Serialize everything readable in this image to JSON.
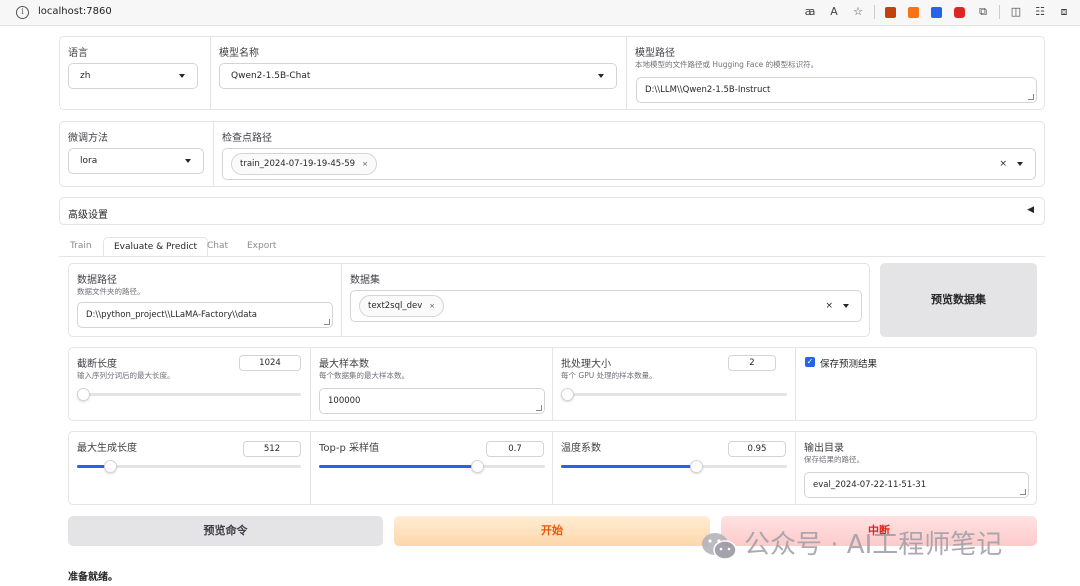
{
  "browser": {
    "url": "localhost:7860"
  },
  "row1": {
    "lang_label": "语言",
    "lang_value": "zh",
    "model_name_label": "模型名称",
    "model_name_value": "Qwen2-1.5B-Chat",
    "model_path_label": "模型路径",
    "model_path_hint": "本地模型的文件路径或 Hugging Face 的模型标识符。",
    "model_path_value": "D:\\\\LLM\\\\Qwen2-1.5B-Instruct"
  },
  "row2": {
    "finetune_label": "微调方法",
    "finetune_value": "lora",
    "checkpoint_label": "检查点路径",
    "checkpoint_tag": "train_2024-07-19-19-45-59",
    "tag_close": "×",
    "clear_all": "×"
  },
  "advanced": {
    "label": "高级设置",
    "toggle": "◀"
  },
  "tabs": [
    {
      "label": "Train"
    },
    {
      "label": "Evaluate & Predict"
    },
    {
      "label": "Chat"
    },
    {
      "label": "Export"
    }
  ],
  "dataset_row": {
    "data_dir_label": "数据路径",
    "data_dir_hint": "数据文件夹的路径。",
    "data_dir_value": "D:\\\\python_project\\\\LLaMA-Factory\\\\data",
    "dataset_label": "数据集",
    "dataset_tag": "text2sql_dev",
    "preview_button": "预览数据集"
  },
  "params_row1": {
    "cutoff_label": "截断长度",
    "cutoff_hint": "输入序列分词后的最大长度。",
    "cutoff_value": "1024",
    "cutoff_fraction": 0.02,
    "max_samples_label": "最大样本数",
    "max_samples_hint": "每个数据集的最大样本数。",
    "max_samples_value": "100000",
    "batch_label": "批处理大小",
    "batch_hint": "每个 GPU 处理的样本数量。",
    "batch_value": "2",
    "batch_fraction": 0.0,
    "save_pred_label": "保存预测结果",
    "save_pred_checked": true
  },
  "params_row2": {
    "max_new_label": "最大生成长度",
    "max_new_value": "512",
    "max_new_fraction": 0.15,
    "top_p_label": "Top-p 采样值",
    "top_p_value": "0.7",
    "top_p_fraction": 0.7,
    "temp_label": "温度系数",
    "temp_value": "0.95",
    "temp_fraction": 0.6,
    "output_label": "输出目录",
    "output_hint": "保存结果的路径。",
    "output_value": "eval_2024-07-22-11-51-31"
  },
  "actions": {
    "preview_cmd": "预览命令",
    "start": "开始",
    "abort": "中断"
  },
  "status": "准备就绪。",
  "watermark": "公众号 · AI工程师笔记",
  "colors": {
    "accent": "#2563eb",
    "start_bg": "#fed7aa",
    "start_text": "#ea580c",
    "abort_bg": "#fecaca",
    "abort_text": "#dc2626",
    "secondary_bg": "#e4e4e7"
  }
}
